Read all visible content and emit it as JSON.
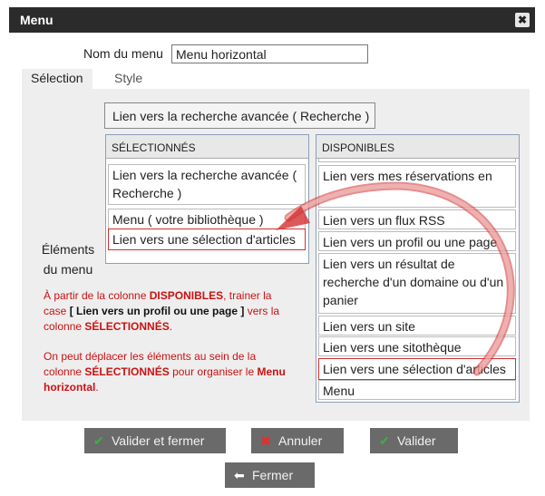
{
  "dialog": {
    "title": "Menu",
    "close_glyph": "✖"
  },
  "form": {
    "name_label": "Nom du menu",
    "name_value": "Menu horizontal"
  },
  "tabs": [
    {
      "label": "Sélection",
      "active": true
    },
    {
      "label": "Style",
      "active": false
    }
  ],
  "top_item": "Lien vers la recherche avancée ( Recherche )",
  "selected": {
    "header": "SÉLECTIONNÉS",
    "items": [
      "Lien vers la recherche avancée ( Recherche )",
      "Menu ( votre bibliothèque )",
      "Lien vers une sélection d'articles"
    ]
  },
  "available": {
    "header": "DISPONIBLES",
    "items": [
      "Lien vers mes réservations en",
      "Lien vers un flux RSS",
      "Lien vers un profil ou une page",
      "Lien vers un résultat de recherche d'un domaine ou d'un panier",
      "Lien vers un site",
      "Lien vers une sitothèque",
      "Lien vers une sélection d'articles",
      "Menu"
    ]
  },
  "elements_label": "Éléments du menu",
  "help": {
    "p1_a": "À partir de la  colonne ",
    "p1_b": "DISPONIBLES",
    "p1_c": ", trainer la case ",
    "p1_d": "[ Lien vers un profil ou une page ]",
    "p1_e": " vers la colonne ",
    "p1_f": "SÉLECTIONNÉS",
    "p1_g": ".",
    "p2_a": "On peut  déplacer les éléments au sein de la colonne ",
    "p2_b": "SÉLECTIONNÉS",
    "p2_c": " pour organiser le ",
    "p2_d": "Menu horizontal",
    "p2_e": "."
  },
  "buttons": {
    "validate_close": "Valider et fermer",
    "cancel": "Annuler",
    "validate": "Valider",
    "close": "Fermer"
  },
  "colors": {
    "titlebar": "#2b2b2b",
    "button": "#6a6a6a",
    "check": "#3cb043",
    "cancel_x": "#e03030",
    "highlight": "#d23030"
  }
}
